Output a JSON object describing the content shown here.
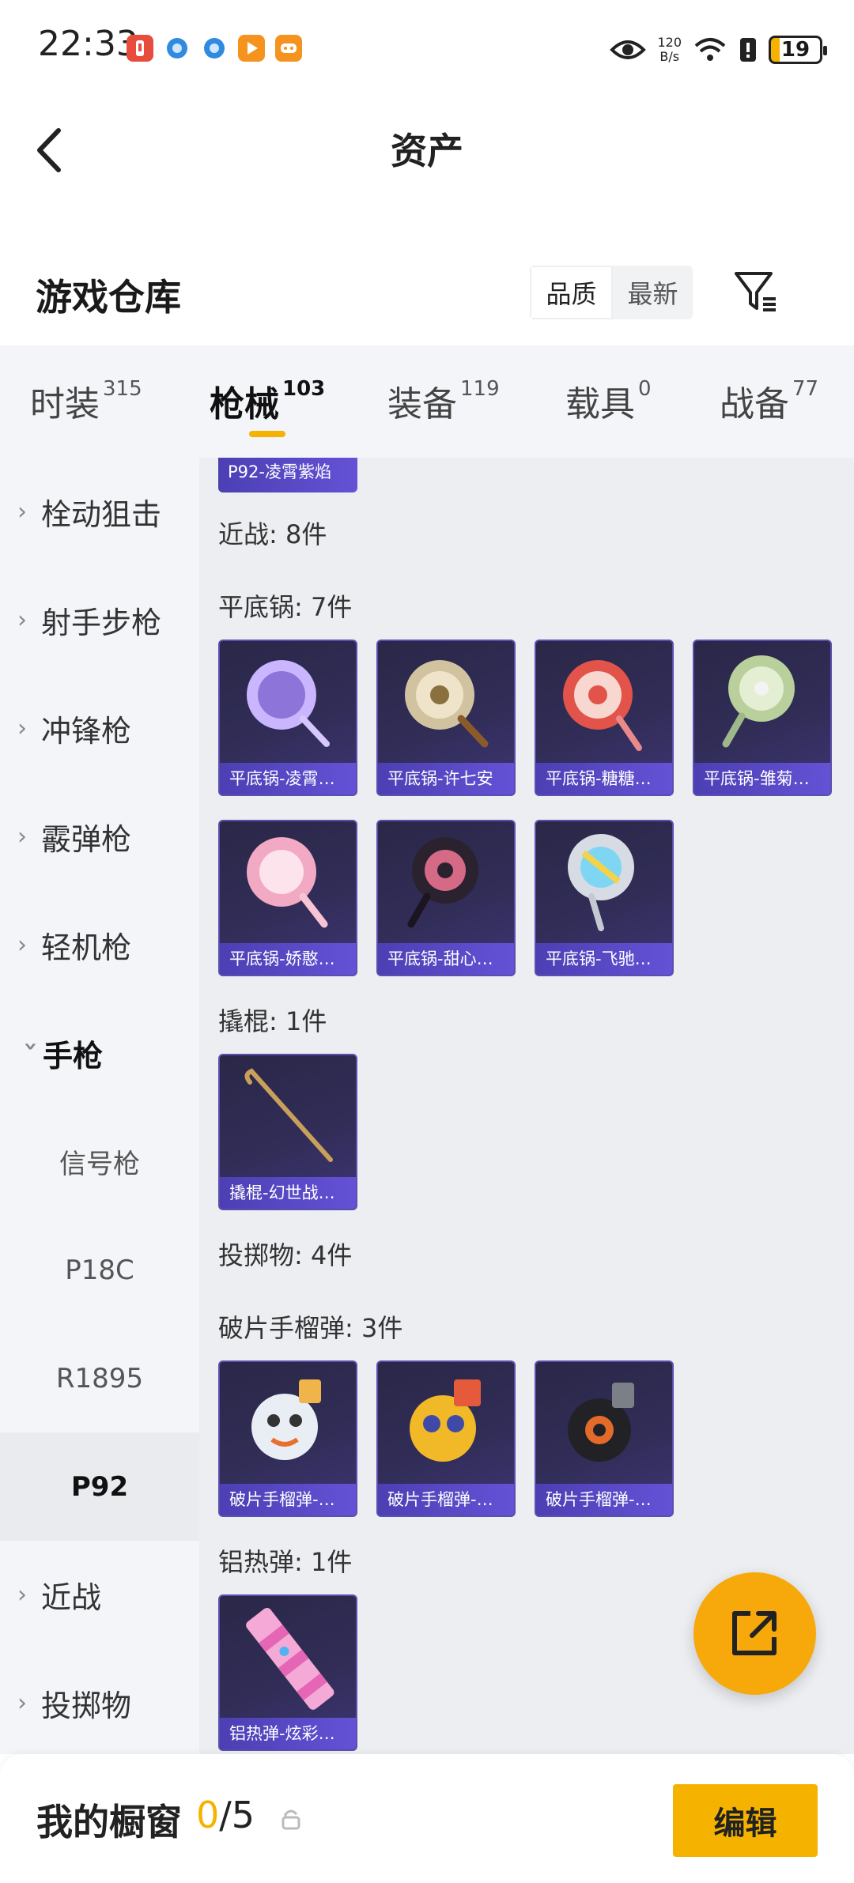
{
  "status_bar": {
    "time": "22:33",
    "net_speed_value": "120",
    "net_speed_unit": "B/s",
    "battery": "19",
    "icons": [
      "app-notification-red-icon",
      "browser-blue-icon",
      "browser-blue-icon",
      "video-orange-icon",
      "game-orange-icon",
      "eye-icon",
      "wifi-icon",
      "alert-icon",
      "battery-icon"
    ]
  },
  "nav": {
    "title": "资产"
  },
  "warehouse": {
    "title": "游戏仓库",
    "sort_options": [
      "品质",
      "最新"
    ],
    "sort_active": "品质"
  },
  "tabs": [
    {
      "label": "时装",
      "count": "315"
    },
    {
      "label": "枪械",
      "count": "103"
    },
    {
      "label": "装备",
      "count": "119"
    },
    {
      "label": "载具",
      "count": "0"
    },
    {
      "label": "战备",
      "count": "77"
    }
  ],
  "active_tab": "枪械",
  "sidebar": {
    "items": [
      {
        "label": "栓动狙击"
      },
      {
        "label": "射手步枪"
      },
      {
        "label": "冲锋枪"
      },
      {
        "label": "霰弹枪"
      },
      {
        "label": "轻机枪"
      },
      {
        "label": "手枪"
      },
      {
        "label": "信号枪"
      },
      {
        "label": "P18C"
      },
      {
        "label": "R1895"
      },
      {
        "label": "P92"
      },
      {
        "label": "近战"
      },
      {
        "label": "投掷物"
      }
    ]
  },
  "content": {
    "top_card_caption": "P92-凌霄紫焰",
    "sections": [
      {
        "label": "近战: 8件"
      },
      {
        "label": "平底锅: 7件"
      },
      {
        "label": "撬棍: 1件"
      },
      {
        "label": "投掷物: 4件"
      },
      {
        "label": "破片手榴弹: 3件"
      },
      {
        "label": "铝热弹: 1件"
      }
    ],
    "pan_cards": [
      {
        "caption": "平底锅-凌霄…"
      },
      {
        "caption": "平底锅-许七安"
      },
      {
        "caption": "平底锅-糖糖…"
      },
      {
        "caption": "平底锅-雏菊…"
      },
      {
        "caption": "平底锅-娇憨…"
      },
      {
        "caption": "平底锅-甜心…"
      },
      {
        "caption": "平底锅-飞驰…"
      }
    ],
    "crowbar_cards": [
      {
        "caption": "撬棍-幻世战…"
      }
    ],
    "grenade_cards": [
      {
        "caption": "破片手榴弹-…"
      },
      {
        "caption": "破片手榴弹-…"
      },
      {
        "caption": "破片手榴弹-…"
      }
    ],
    "thermite_cards": [
      {
        "caption": "铝热弹-炫彩…"
      }
    ]
  },
  "bottom_bar": {
    "label": "我的橱窗",
    "count_current": "0",
    "count_total": "/5",
    "edit_label": "编辑"
  },
  "colors": {
    "accent": "#f5b300",
    "card_bg": "#2e2a52",
    "card_caption": "#5a4ac8",
    "fab": "#f7a90b"
  }
}
